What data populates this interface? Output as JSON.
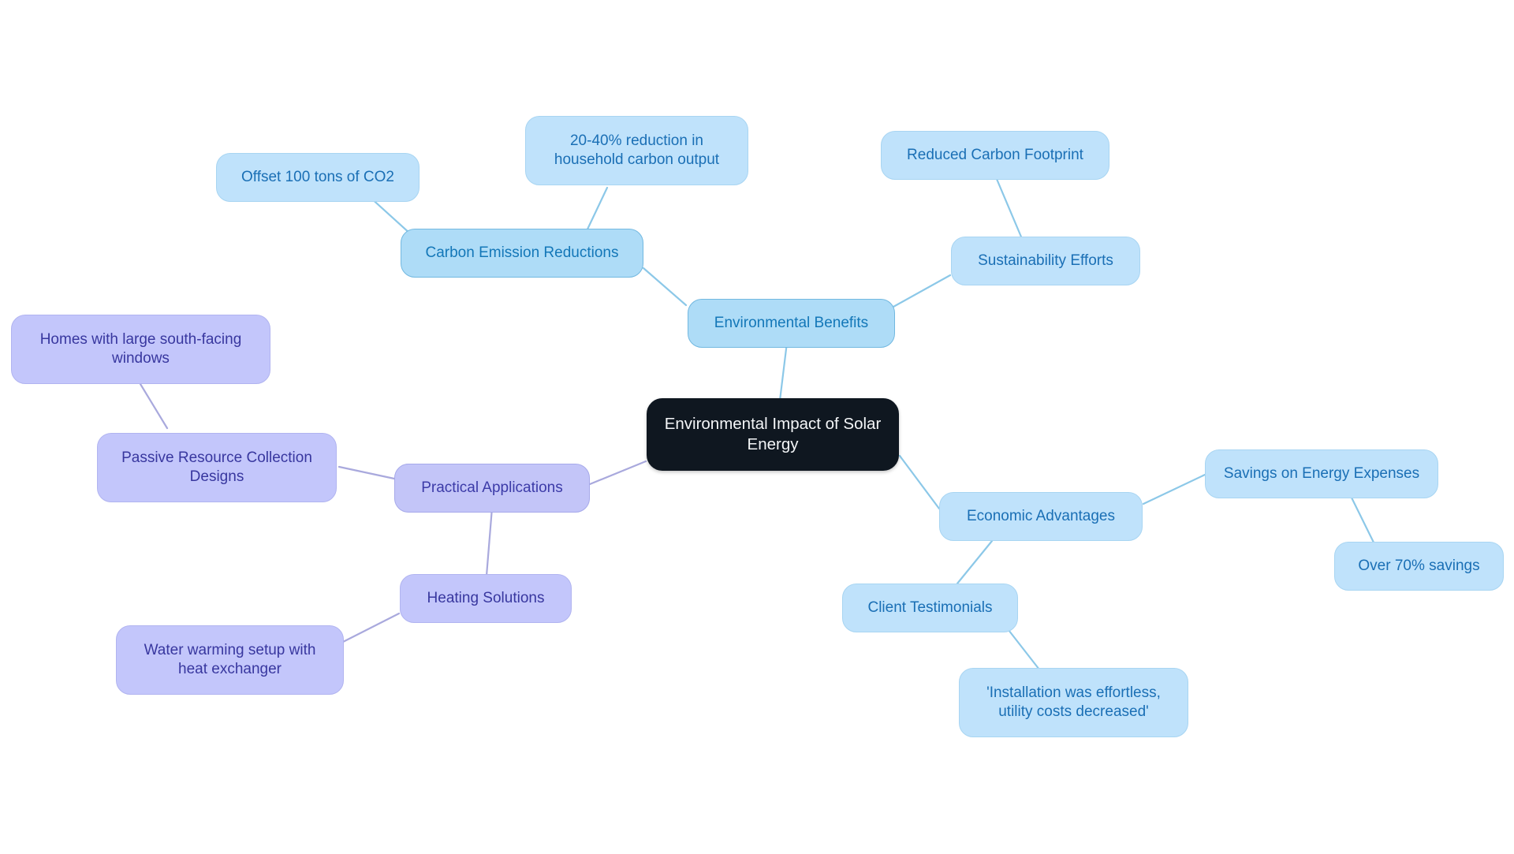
{
  "diagram": {
    "type": "mindmap",
    "title": "Environmental Impact of Solar Energy",
    "background_color": "#ffffff",
    "colors": {
      "root_fill": "#0f1720",
      "root_text": "#f4f6f8",
      "blue_branch_fill": "#aedcf7",
      "blue_branch_border": "#72b8e0",
      "blue_branch_text": "#1377b8",
      "blue_leaf_fill": "#bfe2fb",
      "blue_leaf_border": "#a8d5f2",
      "blue_leaf_text": "#1a6fb5",
      "purple_fill": "#c3c5f8",
      "purple_border": "#a6a9ea",
      "purple_text": "#3c3ba8",
      "edge_blue": "#8cc8e8",
      "edge_purple": "#a9a9dd"
    }
  },
  "nodes": {
    "root": {
      "label": "Environmental Impact of Solar Energy"
    },
    "environmental_benefits": {
      "label": "Environmental Benefits"
    },
    "carbon_emission_reductions": {
      "label": "Carbon Emission Reductions"
    },
    "offset_100_tons": {
      "label": "Offset 100 tons of CO2"
    },
    "reduction_household": {
      "label": "20-40% reduction in\nhousehold carbon output"
    },
    "sustainability_efforts": {
      "label": "Sustainability Efforts"
    },
    "reduced_carbon_footprint": {
      "label": "Reduced Carbon Footprint"
    },
    "economic_advantages": {
      "label": "Economic Advantages"
    },
    "savings_energy_expenses": {
      "label": "Savings on Energy Expenses"
    },
    "over_70_savings": {
      "label": "Over 70% savings"
    },
    "client_testimonials": {
      "label": "Client Testimonials"
    },
    "installation_quote": {
      "label": "'Installation was effortless,\nutility costs decreased'"
    },
    "practical_applications": {
      "label": "Practical Applications"
    },
    "passive_resource_designs": {
      "label": "Passive Resource Collection\nDesigns"
    },
    "homes_south_facing": {
      "label": "Homes with large south-facing\nwindows"
    },
    "heating_solutions": {
      "label": "Heating Solutions"
    },
    "water_warming_setup": {
      "label": "Water warming setup with\nheat exchanger"
    }
  }
}
